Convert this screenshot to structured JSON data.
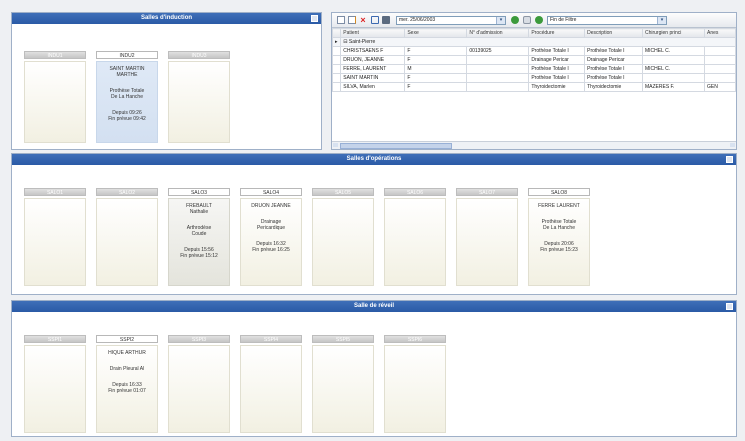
{
  "induction": {
    "title": "Salles d'induction",
    "rooms": [
      {
        "label": "INDU1",
        "state": "empty"
      },
      {
        "label": "INDU2",
        "state": "occupied",
        "patient": [
          "SAINT MARTIN",
          "MARTHE"
        ],
        "procedure": [
          "Prothèse Totale",
          "De La Hanche"
        ],
        "since": "Depuis 09:26",
        "planned_end": "Fin prévue 09:42"
      },
      {
        "label": "INDU3",
        "state": "empty"
      }
    ]
  },
  "grid_panel": {
    "date_value": "mer. 25/06/2003",
    "filter_value": "Fin de Filtre",
    "columns": [
      "Patient",
      "Sexe",
      "N° d'admission",
      "Procédure",
      "Description",
      "Chirurgien princi",
      "Anes"
    ],
    "group_label": "Saint-Pierre",
    "rows": [
      [
        "CHRISTSAENS F",
        "F",
        "00139025",
        "Prothèse Totale I",
        "Prothèse Totale I",
        "MICHEL C.",
        ""
      ],
      [
        "DRUON, JEANNE",
        "F",
        "",
        "Drainage Pericar",
        "Drainage Pericar",
        "",
        ""
      ],
      [
        "FERRE, LAURENT",
        "M",
        "",
        "Prothèse Totale I",
        "Prothèse Totale I",
        "MICHEL C.",
        ""
      ],
      [
        "SAINT MARTIN",
        "F",
        "",
        "Prothèse Totale I",
        "Prothèse Totale I",
        "",
        ""
      ],
      [
        "SILVA, Marlen",
        "F",
        "",
        "Thyroidectomie",
        "Thyroidectomie",
        "MAZERES F.",
        "GEN"
      ]
    ]
  },
  "operating": {
    "title": "Salles d'opérations",
    "rooms": [
      {
        "label": "SALO1",
        "state": "empty"
      },
      {
        "label": "SALO2",
        "state": "empty"
      },
      {
        "label": "SALO3",
        "state": "busy",
        "patient": [
          "FREBAULT",
          "Nathalie"
        ],
        "procedure": [
          "Arthrodèse",
          "Coude"
        ],
        "since": "Depuis 15:56",
        "planned_end": "Fin prévue 15:12"
      },
      {
        "label": "SALO4",
        "state": "occupied",
        "patient": [
          "DRUON JEANNE"
        ],
        "procedure": [
          "Drainage",
          "Pericardique"
        ],
        "since": "Depuis 16:32",
        "planned_end": "Fin prévue 16:25"
      },
      {
        "label": "SALO5",
        "state": "empty"
      },
      {
        "label": "SALO6",
        "state": "empty"
      },
      {
        "label": "SALO7",
        "state": "empty"
      },
      {
        "label": "SALO8",
        "state": "occupied",
        "patient": [
          "FERRE LAURENT"
        ],
        "procedure": [
          "Prothèse Totale",
          "De La Hanche"
        ],
        "since": "Depuis 20:06",
        "planned_end": "Fin prévue 15:23"
      }
    ]
  },
  "recovery": {
    "title": "Salle de réveil",
    "rooms": [
      {
        "label": "SSPI1",
        "state": "empty"
      },
      {
        "label": "SSPI2",
        "state": "occupied",
        "patient": [
          "HIQUE ARTHUR"
        ],
        "procedure": [
          "Drain Pleural Al"
        ],
        "since": "Depuis 16:33",
        "planned_end": "Fin prévue 01:07"
      },
      {
        "label": "SSPI3",
        "state": "empty"
      },
      {
        "label": "SSPI4",
        "state": "empty"
      },
      {
        "label": "SSPI5",
        "state": "empty"
      },
      {
        "label": "SSPI6",
        "state": "empty"
      }
    ]
  }
}
